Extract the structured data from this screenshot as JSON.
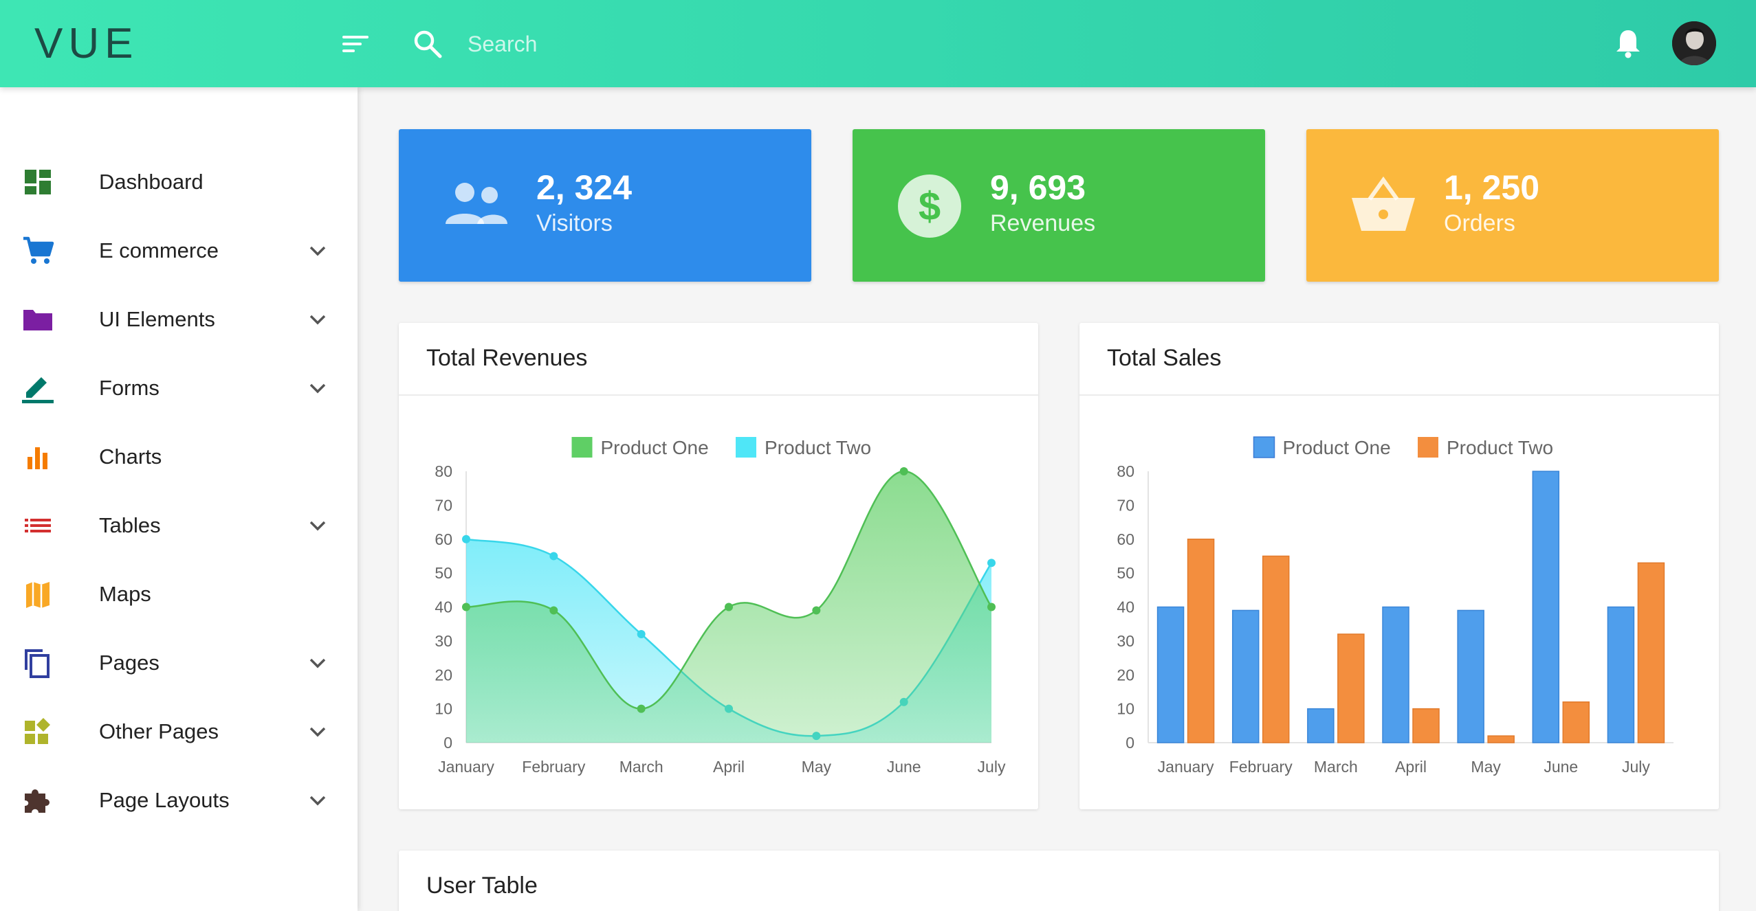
{
  "header": {
    "logo": "VUE",
    "search_placeholder": "Search"
  },
  "sidebar": {
    "items": [
      {
        "label": "Dashboard",
        "icon": "dashboard-icon",
        "color": "#2e7d32",
        "expandable": false
      },
      {
        "label": "E commerce",
        "icon": "cart-icon",
        "color": "#1976d2",
        "expandable": true
      },
      {
        "label": "UI Elements",
        "icon": "folder-icon",
        "color": "#7b1fa2",
        "expandable": true
      },
      {
        "label": "Forms",
        "icon": "pencil-icon",
        "color": "#00796b",
        "expandable": true
      },
      {
        "label": "Charts",
        "icon": "bar-chart-icon",
        "color": "#f57c00",
        "expandable": false
      },
      {
        "label": "Tables",
        "icon": "list-icon",
        "color": "#d32f2f",
        "expandable": true
      },
      {
        "label": "Maps",
        "icon": "map-icon",
        "color": "#f9a825",
        "expandable": false
      },
      {
        "label": "Pages",
        "icon": "pages-icon",
        "color": "#303f9f",
        "expandable": true
      },
      {
        "label": "Other Pages",
        "icon": "widgets-icon",
        "color": "#afb42b",
        "expandable": true
      },
      {
        "label": "Page Layouts",
        "icon": "puzzle-icon",
        "color": "#4e342e",
        "expandable": true
      }
    ]
  },
  "stats": [
    {
      "value": "2, 324",
      "label": "Visitors",
      "icon": "people-icon",
      "color": "#2e8ceb"
    },
    {
      "value": "9, 693",
      "label": "Revenues",
      "icon": "dollar-icon",
      "color": "#46c34c"
    },
    {
      "value": "1, 250",
      "label": "Orders",
      "icon": "basket-icon",
      "color": "#fbb83d"
    }
  ],
  "panels": {
    "revenues_title": "Total Revenues",
    "sales_title": "Total Sales",
    "user_table_title": "User Table"
  },
  "chart_data": [
    {
      "type": "area",
      "title": "Total Revenues",
      "categories": [
        "January",
        "February",
        "March",
        "April",
        "May",
        "June",
        "July"
      ],
      "series": [
        {
          "name": "Product One",
          "values": [
            40,
            39,
            10,
            40,
            39,
            80,
            40
          ],
          "color": "#5fcf65"
        },
        {
          "name": "Product Two",
          "values": [
            60,
            55,
            32,
            10,
            2,
            12,
            53
          ],
          "color": "#4fe6f7"
        }
      ],
      "ylim": [
        0,
        80
      ],
      "yticks": [
        0,
        10,
        20,
        30,
        40,
        50,
        60,
        70,
        80
      ],
      "legend": "top-center",
      "grid": false
    },
    {
      "type": "bar",
      "title": "Total Sales",
      "categories": [
        "January",
        "February",
        "March",
        "April",
        "May",
        "June",
        "July"
      ],
      "series": [
        {
          "name": "Product One",
          "values": [
            40,
            39,
            10,
            40,
            39,
            80,
            40
          ],
          "color": "#4f9eec"
        },
        {
          "name": "Product Two",
          "values": [
            60,
            55,
            32,
            10,
            2,
            12,
            53
          ],
          "color": "#f38e3e"
        }
      ],
      "ylim": [
        0,
        80
      ],
      "yticks": [
        0,
        10,
        20,
        30,
        40,
        50,
        60,
        70,
        80
      ],
      "legend": "top-center",
      "grid": false
    }
  ]
}
